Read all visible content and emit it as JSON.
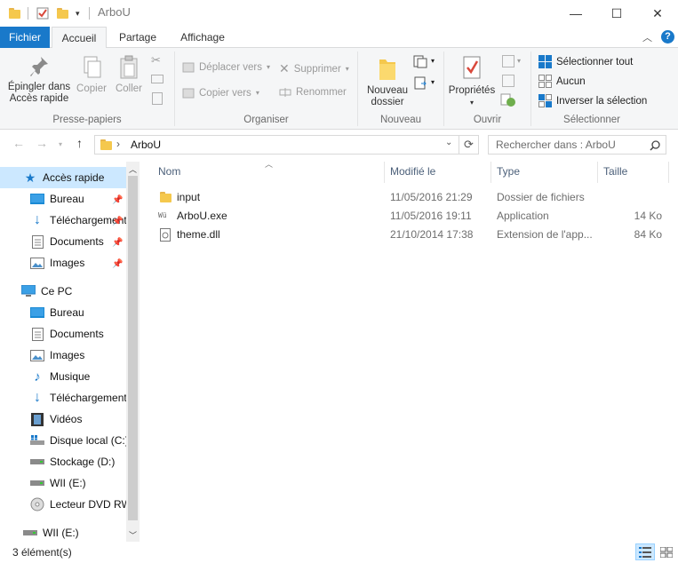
{
  "window": {
    "title": "ArboU",
    "minimize": "—",
    "maximize": "☐",
    "close": "✕"
  },
  "tabs": {
    "file": "Fichier",
    "home": "Accueil",
    "share": "Partage",
    "view": "Affichage"
  },
  "ribbon": {
    "clipboard": {
      "pin_line1": "Épingler dans",
      "pin_line2": "Accès rapide",
      "copy": "Copier",
      "paste": "Coller",
      "label": "Presse-papiers"
    },
    "organize": {
      "move_to": "Déplacer vers",
      "copy_to": "Copier vers",
      "delete": "Supprimer",
      "rename": "Renommer",
      "label": "Organiser"
    },
    "new": {
      "new_folder_line1": "Nouveau",
      "new_folder_line2": "dossier",
      "label": "Nouveau"
    },
    "open": {
      "properties": "Propriétés",
      "label": "Ouvrir"
    },
    "select": {
      "select_all": "Sélectionner tout",
      "select_none": "Aucun",
      "invert": "Inverser la sélection",
      "label": "Sélectionner"
    }
  },
  "address": {
    "path": "ArboU",
    "search_placeholder": "Rechercher dans : ArboU"
  },
  "nav": {
    "quick_access": "Accès rapide",
    "qa_items": [
      "Bureau",
      "Téléchargements",
      "Documents",
      "Images"
    ],
    "this_pc": "Ce PC",
    "pc_items": [
      "Bureau",
      "Documents",
      "Images",
      "Musique",
      "Téléchargements",
      "Vidéos",
      "Disque local (C:)",
      "Stockage (D:)",
      "WII (E:)",
      "Lecteur DVD RW"
    ],
    "drive_bottom": "WII (E:)"
  },
  "columns": {
    "name": "Nom",
    "modified": "Modifié le",
    "type": "Type",
    "size": "Taille"
  },
  "files": [
    {
      "name": "input",
      "modified": "11/05/2016 21:29",
      "type": "Dossier de fichiers",
      "size": "",
      "icon": "folder-icon"
    },
    {
      "name": "ArboU.exe",
      "modified": "11/05/2016 19:11",
      "type": "Application",
      "size": "14 Ko",
      "icon": "exe-icon"
    },
    {
      "name": "theme.dll",
      "modified": "21/10/2014 17:38",
      "type": "Extension de l'app...",
      "size": "84 Ko",
      "icon": "dll-icon"
    }
  ],
  "status": {
    "count": "3 élément(s)"
  },
  "colors": {
    "accent": "#1979ca",
    "selection": "#cce8ff",
    "folder": "#f5c84d"
  }
}
